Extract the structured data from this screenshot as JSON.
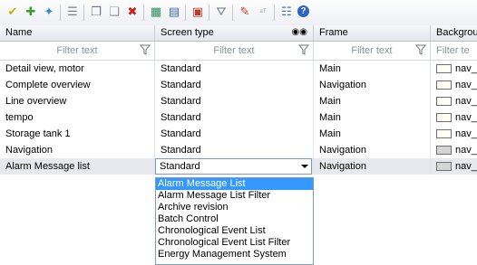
{
  "toolbar": {
    "buttons": [
      {
        "name": "select-all-icon",
        "glyph": "✔",
        "color": "#c8b000"
      },
      {
        "name": "add-row-icon",
        "glyph": "✚",
        "color": "#3a9a2a"
      },
      {
        "name": "favorite-icon",
        "glyph": "✦",
        "color": "#2f8de0"
      },
      {
        "name": "align-icon",
        "glyph": "☰",
        "color": "#7a7f8c"
      },
      {
        "name": "copy-icon",
        "glyph": "❐",
        "color": "#6b7384"
      },
      {
        "name": "paste-icon",
        "glyph": "❏",
        "color": "#8a8f9b"
      },
      {
        "name": "delete-icon",
        "glyph": "✖",
        "color": "#d21b1b"
      },
      {
        "name": "export-icon",
        "glyph": "▦",
        "color": "#2e8b57"
      },
      {
        "name": "import-icon",
        "glyph": "▤",
        "color": "#3b6bb5"
      },
      {
        "name": "screen-icon",
        "glyph": "▣",
        "color": "#c0392b"
      },
      {
        "name": "filter-icon",
        "glyph": "⛛",
        "color": "#6c7380"
      },
      {
        "name": "edit-icon",
        "glyph": "✎",
        "color": "#c0392b"
      },
      {
        "name": "text-icon",
        "glyph": "ᵃᵀ",
        "color": "#9aa1ac"
      },
      {
        "name": "properties-icon",
        "glyph": "☷",
        "color": "#4a6fa5"
      },
      {
        "name": "help-icon",
        "glyph": "?",
        "color": "#ffffff"
      }
    ]
  },
  "columns": [
    {
      "label": "Name"
    },
    {
      "label": "Screen type"
    },
    {
      "label": "Frame"
    },
    {
      "label": "Backgrou"
    }
  ],
  "filter_placeholders": [
    "Filter text",
    "Filter text",
    "Filter text",
    "Filter te"
  ],
  "rows": [
    {
      "name": "Detail view, motor",
      "type": "Standard",
      "frame": "Main",
      "bg": "nav_",
      "swatch": "#fffff4"
    },
    {
      "name": "Complete overview",
      "type": "Standard",
      "frame": "Navigation",
      "bg": "nav_",
      "swatch": "#fffff4"
    },
    {
      "name": "Line overview",
      "type": "Standard",
      "frame": "Main",
      "bg": "nav_",
      "swatch": "#fffff4"
    },
    {
      "name": "tempo",
      "type": "Standard",
      "frame": "Main",
      "bg": "nav_",
      "swatch": "#fffff4"
    },
    {
      "name": "Storage tank 1",
      "type": "Standard",
      "frame": "Main",
      "bg": "nav_",
      "swatch": "#fffff4"
    },
    {
      "name": "Navigation",
      "type": "Standard",
      "frame": "Navigation",
      "bg": "nav_",
      "swatch": "#d4d4d4"
    },
    {
      "name": "Alarm Message list",
      "type": "",
      "frame": "Navigation",
      "bg": "nav_",
      "swatch": "#d4d4d4"
    }
  ],
  "combo": {
    "value": "Standard"
  },
  "dropdown_options": [
    "Alarm Message List",
    "Alarm Message List Filter",
    "Archive revision",
    "Batch Control",
    "Chronological Event List",
    "Chronological Event List Filter",
    "Energy Management System"
  ],
  "colors": {
    "selected_option": "#3399ff",
    "header_bg": "#e7eaf0"
  }
}
